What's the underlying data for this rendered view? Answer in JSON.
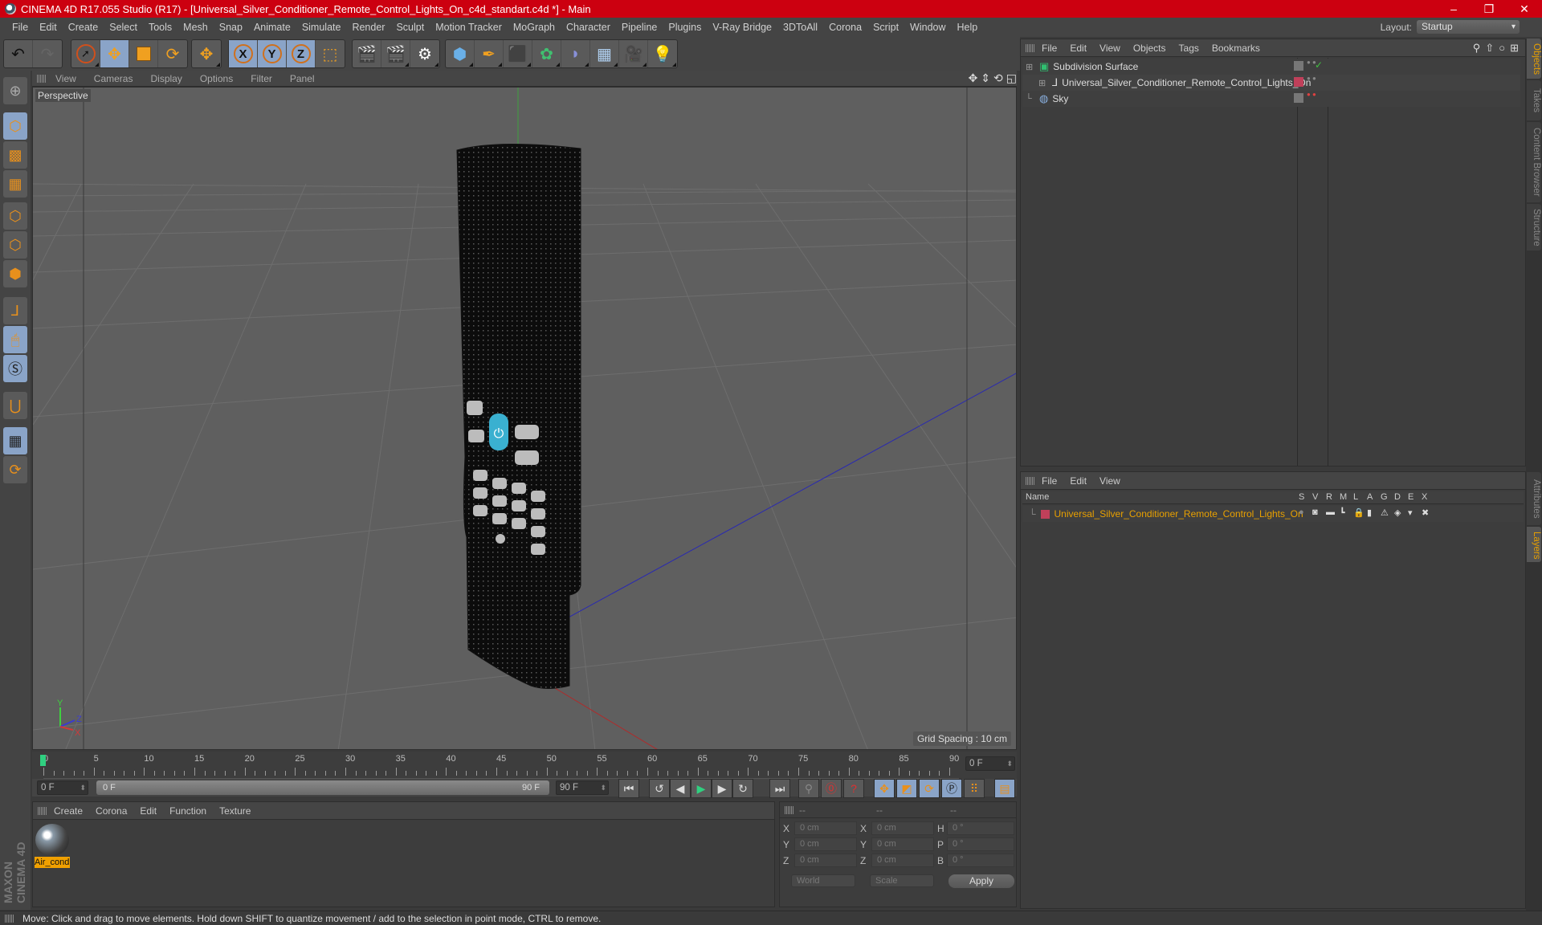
{
  "window": {
    "title": "CINEMA 4D R17.055 Studio (R17) - [Universal_Silver_Conditioner_Remote_Control_Lights_On_c4d_standart.c4d *] - Main",
    "controls": [
      "minimize-icon",
      "restore-icon",
      "close-icon"
    ]
  },
  "menubar": [
    "File",
    "Edit",
    "Create",
    "Select",
    "Tools",
    "Mesh",
    "Snap",
    "Animate",
    "Simulate",
    "Render",
    "Sculpt",
    "Motion Tracker",
    "MoGraph",
    "Character",
    "Pipeline",
    "Plugins",
    "V-Ray Bridge",
    "3DToAll",
    "Corona",
    "Script",
    "Window",
    "Help"
  ],
  "layout": {
    "label": "Layout:",
    "value": "Startup"
  },
  "toolbar": {
    "groups": [
      [
        "undo-icon",
        "redo-icon"
      ],
      [
        "select-icon",
        "move-icon",
        "scale-icon",
        "rotate-icon"
      ],
      [
        "move-alt-icon"
      ],
      [
        "x-axis-icon",
        "y-axis-icon",
        "z-axis-icon",
        "world-coordinates-icon"
      ],
      [
        "render-view-icon",
        "render-picture-viewer-icon",
        "render-settings-icon"
      ],
      [
        "cube-icon",
        "pen-spline-icon",
        "subdivision-icon",
        "array-icon",
        "deformer-icon",
        "floor-icon",
        "camera-icon",
        "light-icon"
      ]
    ],
    "axis_labels": [
      "X",
      "Y",
      "Z"
    ]
  },
  "left_tools": [
    "make-editable-icon",
    "model-mode-icon",
    "texture-mode-icon",
    "workplane-icon",
    "points-mode-icon",
    "edges-mode-icon",
    "polygons-mode-icon",
    "axis-mode-icon",
    "tweak-mode-icon",
    "solo-icon",
    "snap-icon",
    "workplane-lock-icon",
    "workplane-rotate-icon"
  ],
  "viewport": {
    "menu": [
      "View",
      "Cameras",
      "Display",
      "Options",
      "Filter",
      "Panel"
    ],
    "label": "Perspective",
    "grid_spacing": "Grid Spacing : 10 cm",
    "axis_labels": {
      "x": "X",
      "y": "Y",
      "z": "Z"
    }
  },
  "timeline": {
    "ticks": [
      "0",
      "5",
      "10",
      "15",
      "20",
      "25",
      "30",
      "35",
      "40",
      "45",
      "50",
      "55",
      "60",
      "65",
      "70",
      "75",
      "80",
      "85",
      "90"
    ],
    "current_frame": "0 F",
    "start": "0 F",
    "range_start": "0 F",
    "range_end": "90 F",
    "end": "90 F"
  },
  "materials": {
    "menu": [
      "Create",
      "Corona",
      "Edit",
      "Function",
      "Texture"
    ],
    "items": [
      {
        "name": "Air_cond"
      }
    ]
  },
  "coordinates": {
    "headers": [
      "--",
      "--",
      "--"
    ],
    "rows": [
      {
        "l1": "X",
        "v1": "0 cm",
        "l2": "X",
        "v2": "0 cm",
        "l3": "H",
        "v3": "0 °"
      },
      {
        "l1": "Y",
        "v1": "0 cm",
        "l2": "Y",
        "v2": "0 cm",
        "l3": "P",
        "v3": "0 °"
      },
      {
        "l1": "Z",
        "v1": "0 cm",
        "l2": "Z",
        "v2": "0 cm",
        "l3": "B",
        "v3": "0 °"
      }
    ],
    "mode": "World",
    "type": "Scale",
    "apply": "Apply"
  },
  "object_manager": {
    "menu": [
      "File",
      "Edit",
      "View",
      "Objects",
      "Tags",
      "Bookmarks"
    ],
    "objects": [
      {
        "name": "Subdivision Surface",
        "icon": "subdivision-icon"
      },
      {
        "name": "Universal_Silver_Conditioner_Remote_Control_Lights_On",
        "icon": "null-object-icon"
      },
      {
        "name": "Sky",
        "icon": "sky-icon"
      }
    ]
  },
  "layer_manager": {
    "menu": [
      "File",
      "Edit",
      "View"
    ],
    "columns": [
      "Name",
      "S",
      "V",
      "R",
      "M",
      "L",
      "A",
      "G",
      "D",
      "E",
      "X"
    ],
    "layers": [
      {
        "name": "Universal_Silver_Conditioner_Remote_Control_Lights_On",
        "color": "#c0405a"
      }
    ]
  },
  "side_tabs": {
    "top": [
      "Objects",
      "Takes",
      "Content Browser",
      "Structure"
    ],
    "bottom": [
      "Attributes",
      "Layers"
    ]
  },
  "status": "Move: Click and drag to move elements. Hold down SHIFT to quantize movement / add to the selection in point mode, CTRL to remove.",
  "branding": "MAXON CINEMA 4D",
  "colors": {
    "title_bar": "#cc0010",
    "accent_orange": "#e8a000",
    "active_tool": "#8aa4c8"
  }
}
